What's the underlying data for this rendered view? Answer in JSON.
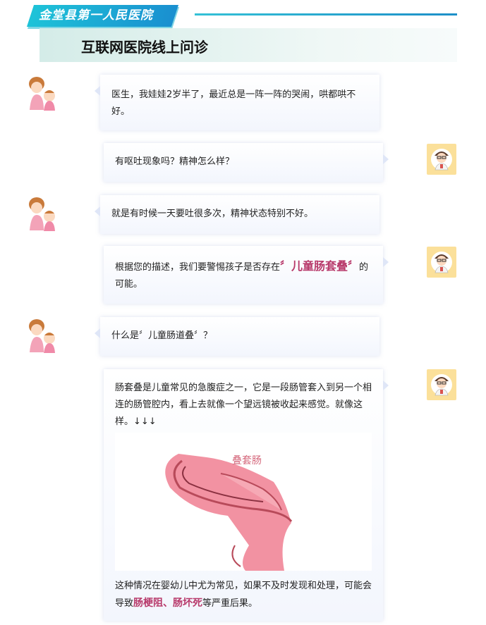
{
  "header": {
    "hospital_name": "金堂县第一人民医院",
    "page_title": "互联网医院线上问诊"
  },
  "messages": [
    {
      "role": "parent",
      "text": "医生，我娃娃2岁半了，最近总是一阵一阵的哭闹，哄都哄不好。"
    },
    {
      "role": "doctor",
      "text": "有呕吐现象吗？精神怎么样？"
    },
    {
      "role": "parent",
      "text": "就是有时候一天要吐很多次，精神状态特别不好。"
    },
    {
      "role": "doctor",
      "text_before": "根据您的描述，我们要警惕孩子是否存在",
      "highlight": "〞儿童肠套叠〞",
      "text_after": "的可能。"
    },
    {
      "role": "parent",
      "text": "什么是〞儿童肠道叠〞？"
    },
    {
      "role": "doctor",
      "text": "肠套叠是儿童常见的急腹症之一，它是一段肠管套入到另一个相连的肠管腔内，看上去就像一个望远镜被收起来感觉。就像这样。↓↓↓",
      "image_caption": "叠套肠",
      "text2_before": "这种情况在婴幼儿中尤为常见，如果不及时发现和处理，可能会导致",
      "highlight2": "肠梗阻、肠坏死",
      "text2_after": "等严重后果。"
    }
  ],
  "colors": {
    "accent_cyan": "#1ec3d8",
    "highlight_pink": "#b83a6b",
    "doctor_avatar_bg": "#fbe09a"
  }
}
